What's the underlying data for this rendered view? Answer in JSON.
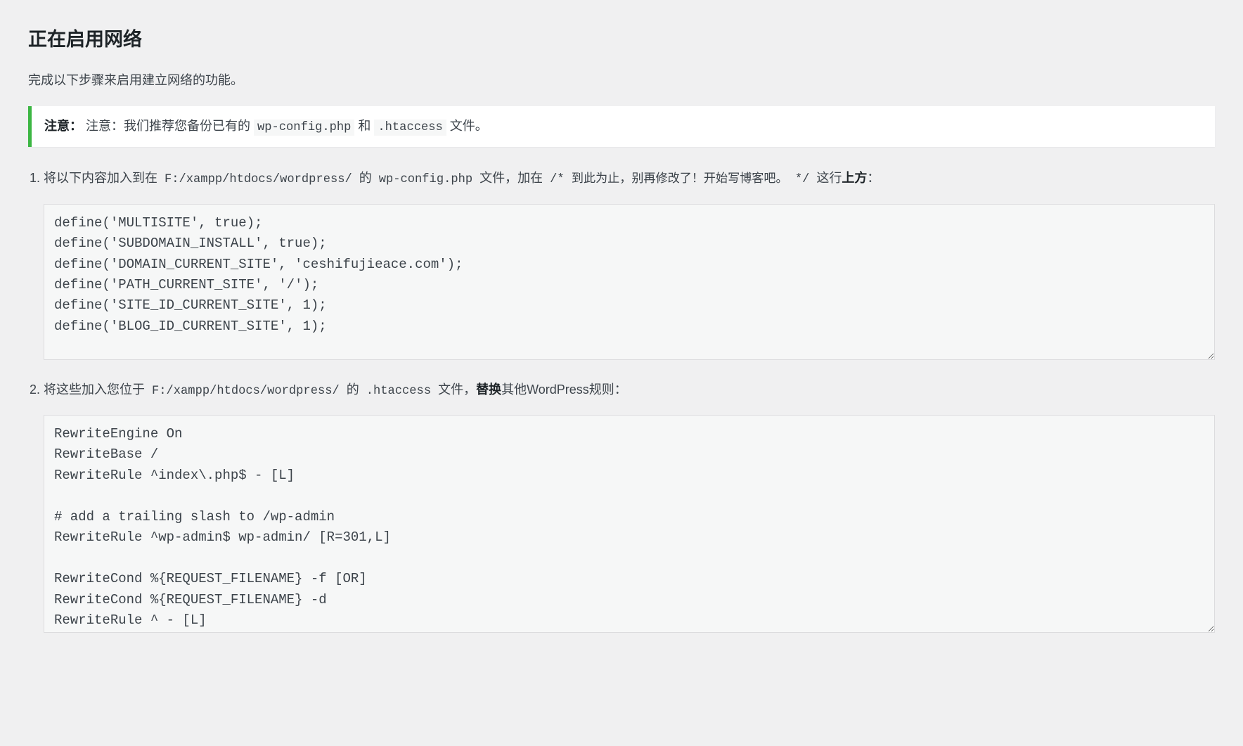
{
  "page": {
    "title": "正在启用网络",
    "intro": "完成以下步骤来启用建立网络的功能。"
  },
  "notice": {
    "label": "注意：",
    "prefix": "注意：我们推荐您备份已有的 ",
    "file1": "wp-config.php",
    "and": " 和 ",
    "file2": ".htaccess",
    "suffix": " 文件。"
  },
  "step1": {
    "text1": "将以下内容加入到在 ",
    "path": "F:/xampp/htdocs/wordpress/",
    "text2": " 的 ",
    "file": "wp-config.php",
    "text3": " 文件，加在 ",
    "comment": "/* 到此为止，别再修改了！开始写博客吧。 */",
    "text4": " 这行",
    "bold": "上方",
    "text5": "：",
    "code": "define('MULTISITE', true);\ndefine('SUBDOMAIN_INSTALL', true);\ndefine('DOMAIN_CURRENT_SITE', 'ceshifujieace.com');\ndefine('PATH_CURRENT_SITE', '/');\ndefine('SITE_ID_CURRENT_SITE', 1);\ndefine('BLOG_ID_CURRENT_SITE', 1);"
  },
  "step2": {
    "text1": "将这些加入您位于 ",
    "path": "F:/xampp/htdocs/wordpress/",
    "text2": " 的 ",
    "file": ".htaccess",
    "text3": " 文件，",
    "bold": "替换",
    "text4": "其他WordPress规则：",
    "code": "RewriteEngine On\nRewriteBase /\nRewriteRule ^index\\.php$ - [L]\n\n# add a trailing slash to /wp-admin\nRewriteRule ^wp-admin$ wp-admin/ [R=301,L]\n\nRewriteCond %{REQUEST_FILENAME} -f [OR]\nRewriteCond %{REQUEST_FILENAME} -d\nRewriteRule ^ - [L]"
  }
}
